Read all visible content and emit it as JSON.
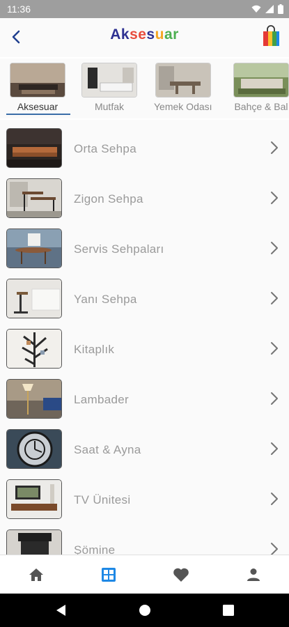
{
  "status_bar": {
    "time": "11:36"
  },
  "app_bar": {
    "title_parts": [
      {
        "text": "Ak",
        "color": "#2e3192"
      },
      {
        "text": "se",
        "color": "#e84c3d"
      },
      {
        "text": "s",
        "color": "#2e3192"
      },
      {
        "text": "u",
        "color": "#f5a623"
      },
      {
        "text": "ar",
        "color": "#4caf50"
      }
    ]
  },
  "categories": [
    {
      "label": "Aksesuar",
      "active": true
    },
    {
      "label": "Mutfak",
      "active": false
    },
    {
      "label": "Yemek Odası",
      "active": false
    },
    {
      "label": "Bahçe & Bal",
      "active": false
    }
  ],
  "items": [
    {
      "label": "Orta Sehpa"
    },
    {
      "label": "Zigon Sehpa"
    },
    {
      "label": "Servis Sehpaları"
    },
    {
      "label": "Yanı Sehpa"
    },
    {
      "label": "Kitaplık"
    },
    {
      "label": "Lambader"
    },
    {
      "label": "Saat & Ayna"
    },
    {
      "label": "TV Ünitesi"
    },
    {
      "label": "Şömine"
    }
  ],
  "bottom_nav": [
    "home-icon",
    "grid-icon",
    "heart-icon",
    "person-icon"
  ],
  "accent_color": "#1e88e5"
}
